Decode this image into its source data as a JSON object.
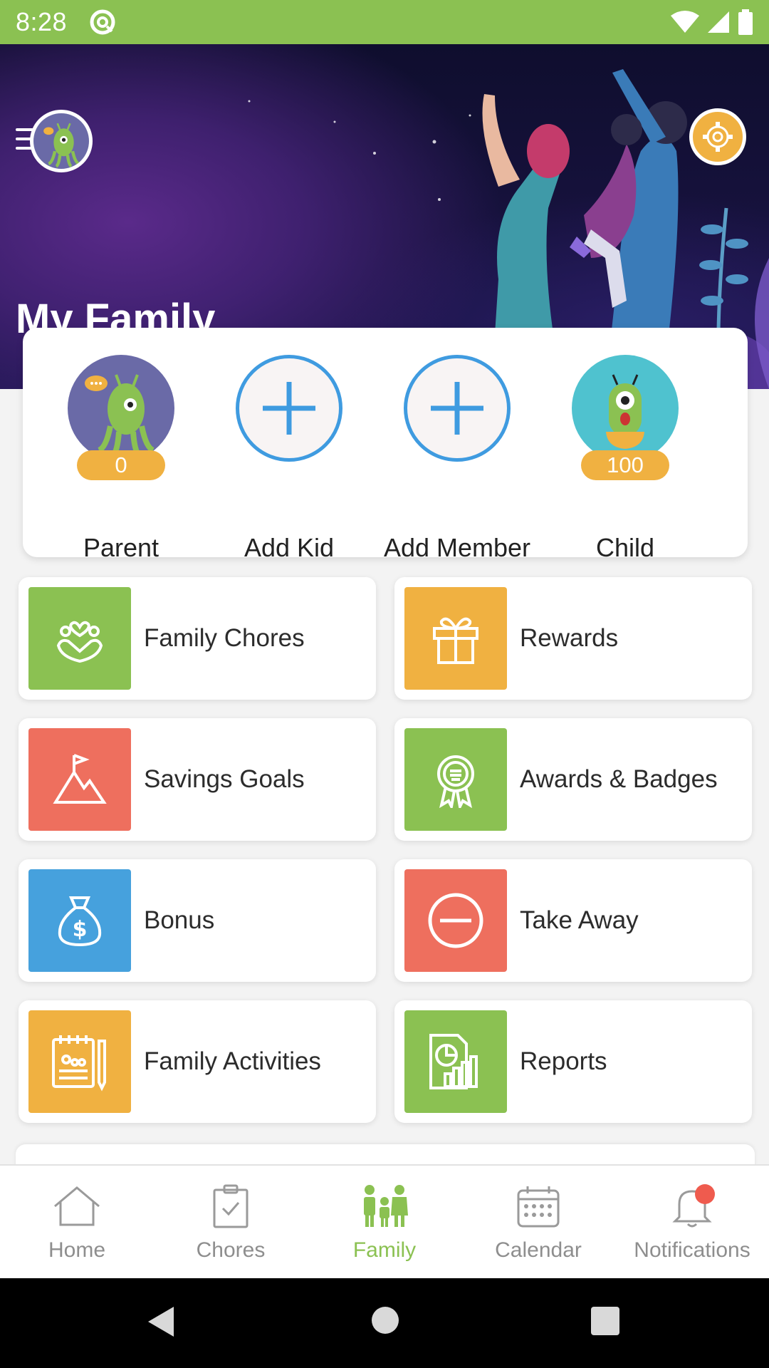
{
  "status_bar": {
    "time": "8:28"
  },
  "header": {
    "title": "My Family"
  },
  "members": [
    {
      "name": "Parent",
      "points": "0",
      "kind": "parent-alien-avatar"
    },
    {
      "name": "Add Kid",
      "kind": "add-plus"
    },
    {
      "name": "Add Member",
      "kind": "add-plus"
    },
    {
      "name": "Child",
      "points": "100",
      "kind": "child-alien-avatar"
    }
  ],
  "tiles": [
    {
      "label": "Family Chores",
      "icon": "family-heart-icon",
      "color": "#8bc152"
    },
    {
      "label": "Rewards",
      "icon": "gift-icon",
      "color": "#f0b141"
    },
    {
      "label": "Savings Goals",
      "icon": "mountain-flag-icon",
      "color": "#ee6f5e"
    },
    {
      "label": "Awards & Badges",
      "icon": "award-ribbon-icon",
      "color": "#8bc152"
    },
    {
      "label": "Bonus",
      "icon": "money-bag-icon",
      "color": "#46a1dd"
    },
    {
      "label": "Take Away",
      "icon": "minus-circle-icon",
      "color": "#ee6f5e"
    },
    {
      "label": "Family Activities",
      "icon": "notepad-pencil-icon",
      "color": "#f0b141"
    },
    {
      "label": "Reports",
      "icon": "report-chart-icon",
      "color": "#8bc152"
    }
  ],
  "bottom_nav": [
    {
      "label": "Home",
      "icon": "home-icon"
    },
    {
      "label": "Chores",
      "icon": "clipboard-check-icon"
    },
    {
      "label": "Family",
      "icon": "family-icon",
      "active": true
    },
    {
      "label": "Calendar",
      "icon": "calendar-icon"
    },
    {
      "label": "Notifications",
      "icon": "bell-icon",
      "badge": true
    }
  ],
  "colors": {
    "accent_green": "#8bc152",
    "accent_orange": "#f0b141",
    "accent_red": "#ee6f5e",
    "accent_blue": "#46a1dd"
  }
}
